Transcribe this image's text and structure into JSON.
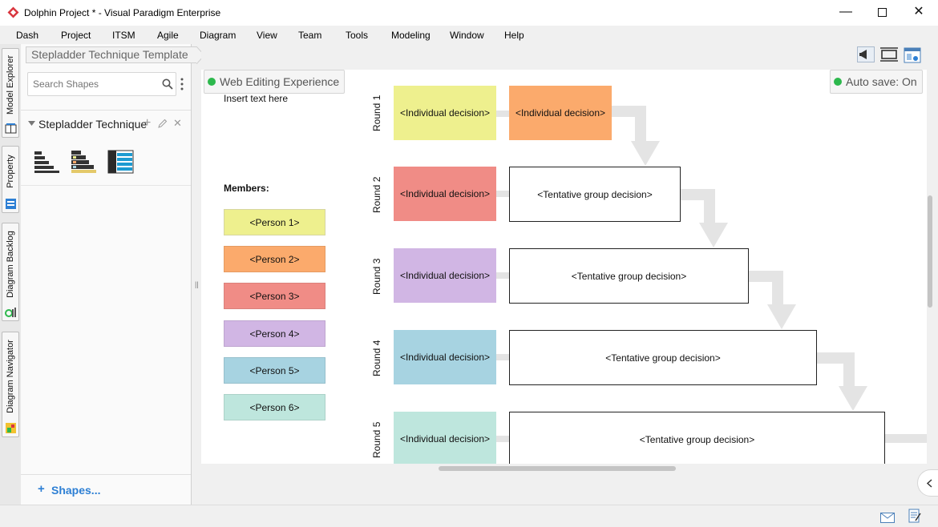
{
  "window": {
    "title": "Dolphin Project * - Visual Paradigm Enterprise"
  },
  "menu": [
    "Dash",
    "Project",
    "ITSM",
    "Agile",
    "Diagram",
    "View",
    "Team",
    "Tools",
    "Modeling",
    "Window",
    "Help"
  ],
  "side_tabs": [
    "Model Explorer",
    "Property",
    "Diagram Backlog",
    "Diagram Navigator"
  ],
  "breadcrumb": "Stepladder Technique Template",
  "search": {
    "placeholder": "Search Shapes"
  },
  "palette": {
    "group_label": "Stepladder Technique",
    "shapes_link": "Shapes..."
  },
  "badges": {
    "web_editing": "Web Editing Experience",
    "autosave": "Auto save: On"
  },
  "diagram": {
    "insert_text": "Insert text here",
    "members_label": "Members:",
    "members": [
      {
        "label": "<Person 1>",
        "color": "#eef08e"
      },
      {
        "label": "<Person 2>",
        "color": "#fbaa6c"
      },
      {
        "label": "<Person 3>",
        "color": "#f08c86"
      },
      {
        "label": "<Person 4>",
        "color": "#d1b6e4"
      },
      {
        "label": "<Person 5>",
        "color": "#a7d3e1"
      },
      {
        "label": "<Person 6>",
        "color": "#bee6dd"
      }
    ],
    "rounds": [
      {
        "label": "Round 1",
        "individual": "<Individual decision>",
        "color": "#eef08e",
        "group": "<Individual decision>",
        "group_color": "#fbaa6c"
      },
      {
        "label": "Round 2",
        "individual": "<Individual decision>",
        "color": "#f08c86",
        "group": "<Tentative group decision>"
      },
      {
        "label": "Round 3",
        "individual": "<Individual decision>",
        "color": "#d1b6e4",
        "group": "<Tentative group decision>"
      },
      {
        "label": "Round 4",
        "individual": "<Individual decision>",
        "color": "#a7d3e1",
        "group": "<Tentative group decision>"
      },
      {
        "label": "Round 5",
        "individual": "<Individual decision>",
        "color": "#bee6dd",
        "group": "<Tentative group decision>"
      }
    ]
  },
  "colors": {
    "accent": "#2d7fd4",
    "status_green": "#2db84d",
    "connector": "#e4e4e4"
  }
}
